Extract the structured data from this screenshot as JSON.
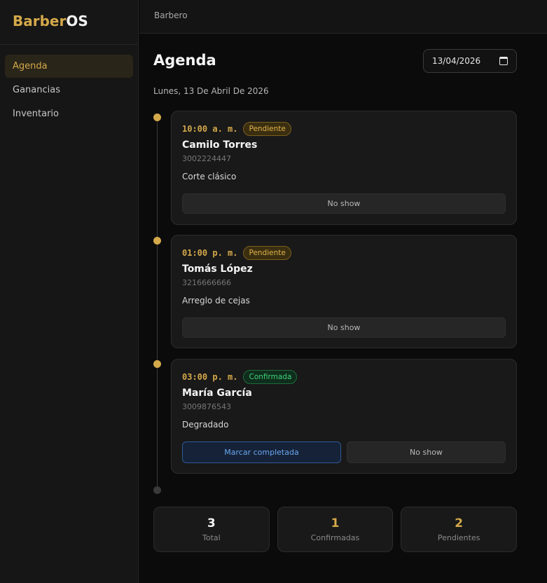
{
  "brand": {
    "part1": "Barber",
    "part2": "OS"
  },
  "sidebar": {
    "items": [
      {
        "label": "Agenda",
        "active": true
      },
      {
        "label": "Ganancias",
        "active": false
      },
      {
        "label": "Inventario",
        "active": false
      }
    ]
  },
  "topbar": {
    "role": "Barbero"
  },
  "page": {
    "title": "Agenda",
    "date_value": "13/04/2026",
    "date_label": "Lunes, 13 De Abril De 2026"
  },
  "appointments": [
    {
      "time": "10:00 a. m.",
      "status": "Pendiente",
      "client": "Camilo Torres",
      "phone": "3002224447",
      "service": "Corte clásico",
      "noshow_label": "No show"
    },
    {
      "time": "01:00 p. m.",
      "status": "Pendiente",
      "client": "Tomás López",
      "phone": "3216666666",
      "service": "Arreglo de cejas",
      "noshow_label": "No show"
    },
    {
      "time": "03:00 p. m.",
      "status": "Confirmada",
      "client": "María García",
      "phone": "3009876543",
      "service": "Degradado",
      "complete_label": "Marcar completada",
      "noshow_label": "No show"
    }
  ],
  "stats": [
    {
      "value": "3",
      "label": "Total"
    },
    {
      "value": "1",
      "label": "Confirmadas"
    },
    {
      "value": "2",
      "label": "Pendientes"
    }
  ],
  "colors": {
    "accent": "#d4a94a",
    "pending": "#e2b44a",
    "confirmed": "#3ed27a",
    "complete": "#6aa8f0"
  },
  "icons": {
    "date_picker": "calendar-icon"
  }
}
